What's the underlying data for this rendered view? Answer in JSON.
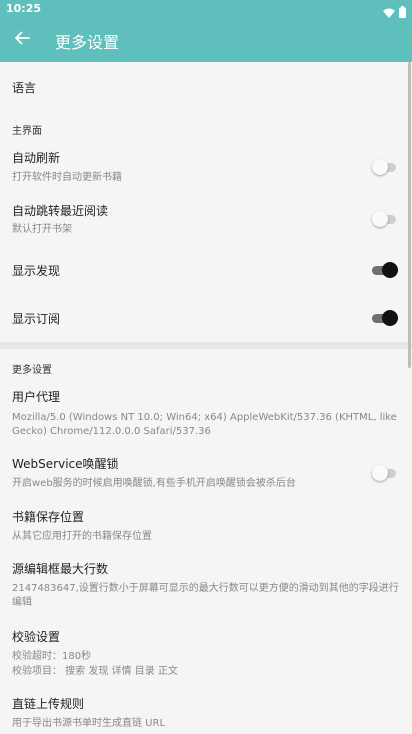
{
  "status": {
    "time": "10:25"
  },
  "appbar": {
    "title": "更多设置"
  },
  "language": {
    "title": "语言"
  },
  "main_ui": {
    "category": "主界面",
    "auto_refresh": {
      "title": "自动刷新",
      "summary": "打开软件时自动更新书籍",
      "enabled": false
    },
    "auto_jump": {
      "title": "自动跳转最近阅读",
      "summary": "默认打开书架",
      "enabled": false
    },
    "show_discovery": {
      "title": "显示发现",
      "enabled": true
    },
    "show_rss": {
      "title": "显示订阅",
      "enabled": true
    }
  },
  "more": {
    "category": "更多设置",
    "user_agent": {
      "title": "用户代理",
      "summary": "Mozilla/5.0 (Windows NT 10.0; Win64; x64) AppleWebKit/537.36 (KHTML, like Gecko) Chrome/112.0.0.0 Safari/537.36"
    },
    "webservice_wakelock": {
      "title": "WebService唤醒锁",
      "summary": "开启web服务的时候启用唤醒锁,有些手机开启唤醒锁会被杀后台",
      "enabled": false
    },
    "book_storage": {
      "title": "书籍保存位置",
      "summary": "从其它应用打开的书籍保存位置"
    },
    "source_editor_max_lines": {
      "title": "源编辑框最大行数",
      "summary": "2147483647,设置行数小于屏幕可显示的最大行数可以更方便的滑动到其他的字段进行编辑"
    },
    "check_settings": {
      "title": "校验设置",
      "timeout_line": "校验超时：180秒",
      "items_line": "校验项目：  搜索 发现 详情 目录 正文"
    },
    "direct_link_rule": {
      "title": "直链上传规则",
      "summary": "用于导出书源书单时生成直链 URL"
    }
  }
}
